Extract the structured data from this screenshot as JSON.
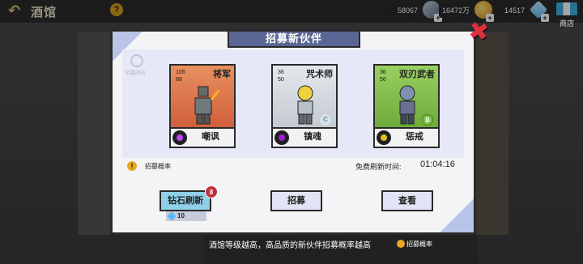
{
  "header": {
    "back_icon": "back-arrow-icon",
    "title": "酒馆",
    "help_label": "?"
  },
  "resources": [
    {
      "name": "weapon-icon",
      "value": "58067"
    },
    {
      "name": "gold-coin-icon",
      "value": "16472万"
    },
    {
      "name": "diamond-icon",
      "value": "14517"
    }
  ],
  "shop": {
    "label": "商店"
  },
  "modal": {
    "title": "招募新伙伴",
    "close_icon": "close-x-icon",
    "timer_label": "招募时间",
    "cards": [
      {
        "name_tag": "将军",
        "atk": "106",
        "def": "88",
        "character": "嘲讽",
        "color": "#d86040",
        "grade": ""
      },
      {
        "name_tag": "咒术师",
        "atk": "36",
        "def": "50",
        "character": "镇魂",
        "color": "#c8d0d8",
        "grade": "C"
      },
      {
        "name_tag": "双刃武者",
        "atk": "36",
        "def": "56",
        "character": "惩戒",
        "color": "#80c040",
        "grade": "B"
      }
    ],
    "rate_label": "招募概率",
    "free_refresh_label": "免费刷新时间:",
    "free_refresh_time": "01:04:16",
    "buttons": {
      "refresh": "钻石刷新",
      "recruit": "招募",
      "view": "查看"
    },
    "refresh_badge": "8",
    "refresh_cost": "10"
  },
  "footer": {
    "tip": "酒馆等级越高，高品质的新伙伴招募概率越高",
    "rate_label": "招募概率"
  }
}
